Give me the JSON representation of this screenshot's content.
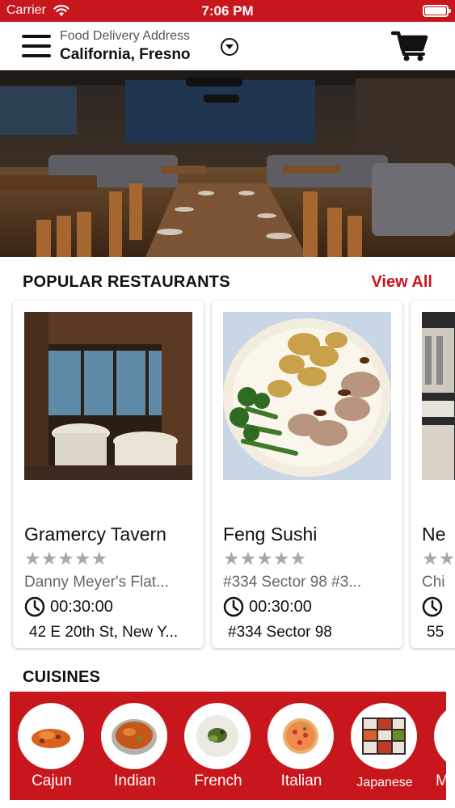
{
  "status_bar": {
    "carrier": "Carrier",
    "time": "7:06 PM"
  },
  "header": {
    "address_label": "Food Delivery Address",
    "address_value": "California, Fresno",
    "menu_icon": "hamburger-menu-icon",
    "dropdown_icon": "chevron-down-circle-icon",
    "cart_icon": "shopping-cart-icon"
  },
  "popular": {
    "title": "POPULAR RESTAURANTS",
    "view_all": "View All",
    "restaurants": [
      {
        "name": "Gramercy Tavern",
        "stars": "★★★★★",
        "rating": 0,
        "description": "Danny Meyer's Flat...",
        "time": "00:30:00",
        "address": "42 E 20th St, New Y..."
      },
      {
        "name": "Feng Sushi",
        "stars": "★★★★★",
        "rating": 0,
        "description": "#334 Sector 98 #3...",
        "time": "00:30:00",
        "address": "#334 Sector 98"
      },
      {
        "name": "Ne",
        "stars": "★★",
        "rating": 0,
        "description": "Chi",
        "time": "",
        "address": "55"
      }
    ]
  },
  "cuisines": {
    "title": "CUISINES",
    "items": [
      {
        "label": "Cajun"
      },
      {
        "label": "Indian"
      },
      {
        "label": "French"
      },
      {
        "label": "Italian"
      },
      {
        "label": "Japanese"
      },
      {
        "label": "M"
      }
    ]
  },
  "colors": {
    "brand_red": "#c8161d",
    "star_gray": "#a8a8a8"
  }
}
